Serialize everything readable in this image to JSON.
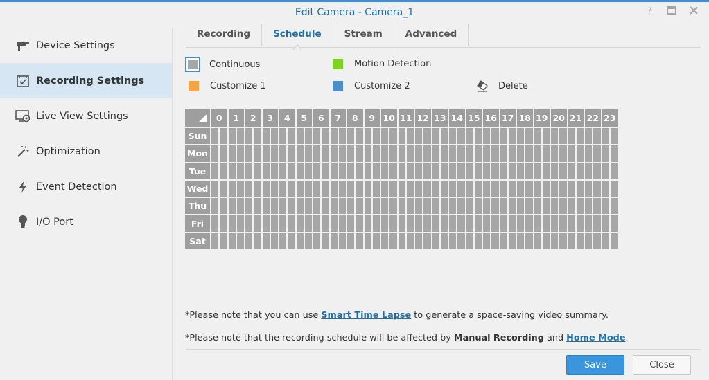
{
  "window": {
    "title": "Edit Camera - Camera_1"
  },
  "sidebar": {
    "items": [
      {
        "label": "Device Settings",
        "icon": "camera-icon"
      },
      {
        "label": "Recording Settings",
        "icon": "calendar-icon",
        "active": true
      },
      {
        "label": "Live View Settings",
        "icon": "monitor-icon"
      },
      {
        "label": "Optimization",
        "icon": "magic-wand-icon"
      },
      {
        "label": "Event Detection",
        "icon": "lightning-icon"
      },
      {
        "label": "I/O Port",
        "icon": "bulb-icon"
      }
    ]
  },
  "tabs": [
    {
      "label": "Recording"
    },
    {
      "label": "Schedule",
      "active": true
    },
    {
      "label": "Stream"
    },
    {
      "label": "Advanced"
    }
  ],
  "legend": {
    "continuous": "Continuous",
    "motion": "Motion Detection",
    "custom1": "Customize 1",
    "custom2": "Customize 2",
    "delete": "Delete"
  },
  "colors": {
    "accent": "#1f6fa8",
    "continuous": "#a6a6a6",
    "motion": "#7ed321",
    "custom1": "#f5a343",
    "custom2": "#4a8ccc"
  },
  "schedule": {
    "hours": [
      "0",
      "1",
      "2",
      "3",
      "4",
      "5",
      "6",
      "7",
      "8",
      "9",
      "10",
      "11",
      "12",
      "13",
      "14",
      "15",
      "16",
      "17",
      "18",
      "19",
      "20",
      "21",
      "22",
      "23"
    ],
    "days": [
      "Sun",
      "Mon",
      "Tue",
      "Wed",
      "Thu",
      "Fri",
      "Sat"
    ]
  },
  "notes": {
    "line1_pre": "*Please note that you can use ",
    "line1_link": "Smart Time Lapse",
    "line1_post": " to generate a space-saving video summary.",
    "line2_pre": "*Please note that the recording schedule will be affected by ",
    "line2_bold": "Manual Recording",
    "line2_mid": " and ",
    "line2_link": "Home Mode",
    "line2_post": "."
  },
  "buttons": {
    "save": "Save",
    "close": "Close"
  }
}
